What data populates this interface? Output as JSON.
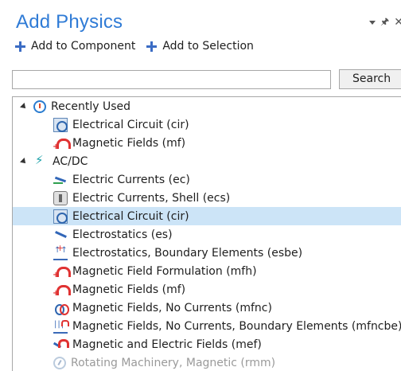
{
  "header": {
    "title": "Add Physics"
  },
  "toolbar": {
    "add_to_component": "Add to Component",
    "add_to_selection": "Add to Selection"
  },
  "search": {
    "value": "",
    "placeholder": "",
    "button_label": "Search"
  },
  "tree": {
    "recently_used": {
      "label": "Recently Used",
      "items": [
        {
          "label": "Electrical Circuit (cir)",
          "icon": "electrical-circuit-icon"
        },
        {
          "label": "Magnetic Fields (mf)",
          "icon": "magnet-icon"
        }
      ]
    },
    "acdc": {
      "label": "AC/DC",
      "items": [
        {
          "label": "Electric Currents (ec)",
          "icon": "electric-currents-icon"
        },
        {
          "label": "Electric Currents, Shell (ecs)",
          "icon": "shell-icon"
        },
        {
          "label": "Electrical Circuit (cir)",
          "icon": "electrical-circuit-icon",
          "selected": true
        },
        {
          "label": "Electrostatics (es)",
          "icon": "electrostatics-icon"
        },
        {
          "label": "Electrostatics, Boundary Elements (esbe)",
          "icon": "boundary-elements-icon"
        },
        {
          "label": "Magnetic Field Formulation (mfh)",
          "icon": "magnet-icon"
        },
        {
          "label": "Magnetic Fields (mf)",
          "icon": "magnet-icon"
        },
        {
          "label": "Magnetic Fields, No Currents (mfnc)",
          "icon": "no-currents-icon"
        },
        {
          "label": "Magnetic Fields, No Currents, Boundary Elements (mfncbe)",
          "icon": "no-currents-boundary-icon"
        },
        {
          "label": "Magnetic and Electric Fields (mef)",
          "icon": "magnetic-electric-icon"
        },
        {
          "label": "Rotating Machinery, Magnetic (rmm)",
          "icon": "rotating-machinery-icon"
        }
      ]
    }
  },
  "colors": {
    "title": "#2f7bd6",
    "selection": "#cce4f7",
    "plus": "#3b6cc4"
  }
}
